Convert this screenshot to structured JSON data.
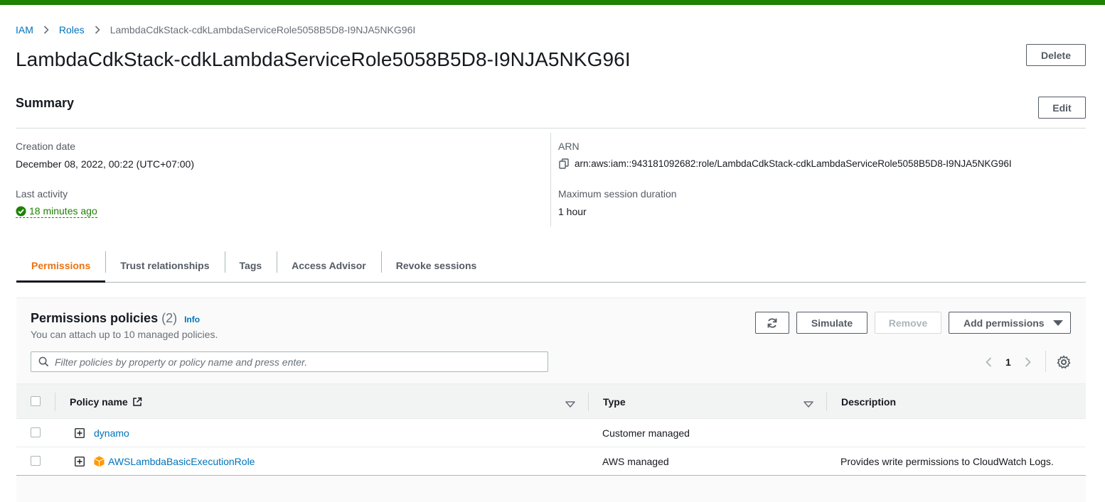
{
  "colors": {
    "success": "#1d8102",
    "link": "#0073bb",
    "accent": "#ec7211"
  },
  "breadcrumb": {
    "items": [
      "IAM",
      "Roles"
    ],
    "current": "LambdaCdkStack-cdkLambdaServiceRole5058B5D8-I9NJA5NKG96I"
  },
  "page": {
    "title": "LambdaCdkStack-cdkLambdaServiceRole5058B5D8-I9NJA5NKG96I",
    "delete_label": "Delete"
  },
  "summary": {
    "title": "Summary",
    "edit_label": "Edit",
    "creation_label": "Creation date",
    "creation_value": "December 08, 2022, 00:22 (UTC+07:00)",
    "activity_label": "Last activity",
    "activity_value": "18 minutes ago",
    "arn_label": "ARN",
    "arn_value": "arn:aws:iam::943181092682:role/LambdaCdkStack-cdkLambdaServiceRole5058B5D8-I9NJA5NKG96I",
    "session_label": "Maximum session duration",
    "session_value": "1 hour"
  },
  "tabs": [
    {
      "label": "Permissions",
      "active": true
    },
    {
      "label": "Trust relationships"
    },
    {
      "label": "Tags"
    },
    {
      "label": "Access Advisor"
    },
    {
      "label": "Revoke sessions"
    }
  ],
  "policies": {
    "title": "Permissions policies",
    "count": "(2)",
    "info": "Info",
    "description": "You can attach up to 10 managed policies.",
    "simulate_label": "Simulate",
    "remove_label": "Remove",
    "add_label": "Add permissions",
    "search_placeholder": "Filter policies by property or policy name and press enter.",
    "page": "1",
    "columns": {
      "name": "Policy name",
      "type": "Type",
      "description": "Description"
    },
    "rows": [
      {
        "name": "dynamo",
        "type": "Customer managed",
        "description": "",
        "aws_icon": false
      },
      {
        "name": "AWSLambdaBasicExecutionRole",
        "type": "AWS managed",
        "description": "Provides write permissions to CloudWatch Logs.",
        "aws_icon": true
      }
    ]
  }
}
